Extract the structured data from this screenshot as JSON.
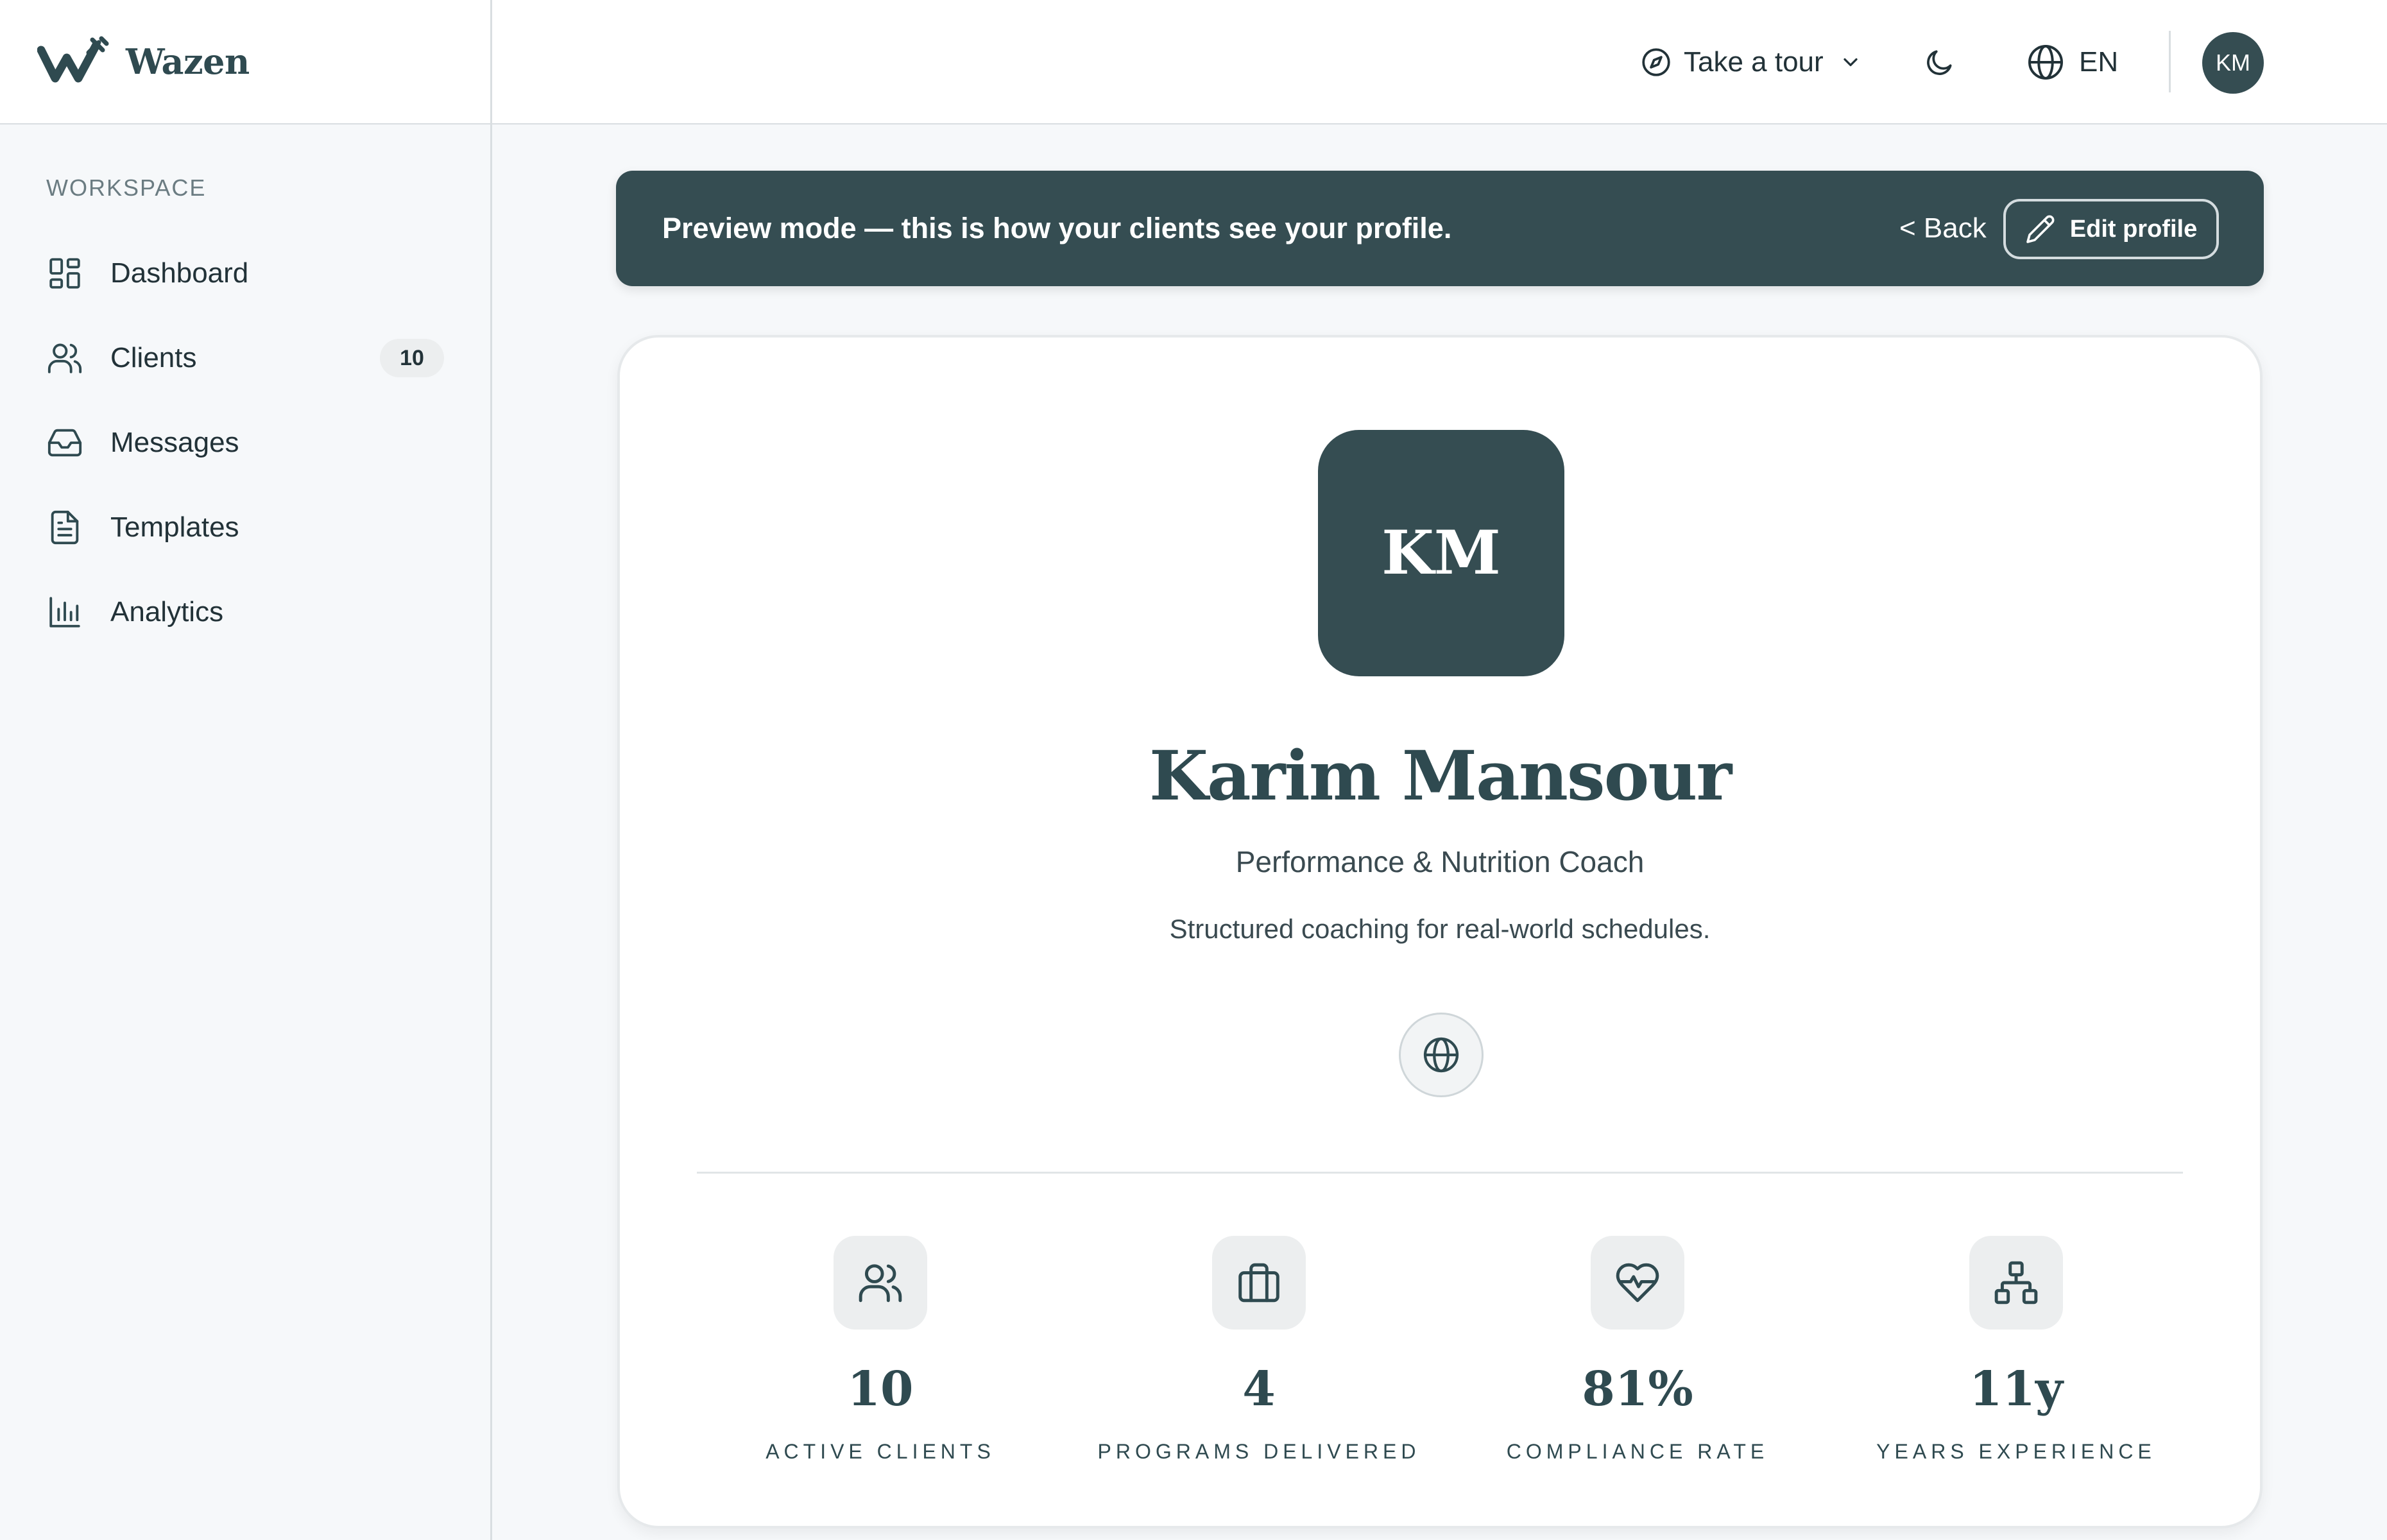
{
  "brand": {
    "name": "Wazen",
    "logo_icon": "wazen-logo-icon"
  },
  "header": {
    "tour_label": "Take a tour",
    "language_label": "EN",
    "avatar_initials": "KM"
  },
  "sidebar": {
    "section_label": "WORKSPACE",
    "items": [
      {
        "label": "Dashboard",
        "icon": "dashboard-icon"
      },
      {
        "label": "Clients",
        "icon": "users-icon",
        "badge": "10"
      },
      {
        "label": "Messages",
        "icon": "inbox-icon"
      },
      {
        "label": "Templates",
        "icon": "document-icon"
      },
      {
        "label": "Analytics",
        "icon": "bar-chart-icon"
      }
    ]
  },
  "banner": {
    "text": "Preview mode — this is how your clients see your profile.",
    "back_label": "< Back",
    "edit_label": "Edit profile"
  },
  "profile": {
    "initials": "KM",
    "name": "Karim Mansour",
    "role": "Performance & Nutrition Coach",
    "tagline": "Structured coaching for real-world schedules.",
    "website_icon": "globe-icon"
  },
  "stats": [
    {
      "value": "10",
      "label": "ACTIVE CLIENTS",
      "icon": "users-icon"
    },
    {
      "value": "4",
      "label": "PROGRAMS DELIVERED",
      "icon": "briefcase-icon"
    },
    {
      "value": "81%",
      "label": "COMPLIANCE RATE",
      "icon": "heart-pulse-icon"
    },
    {
      "value": "11y",
      "label": "YEARS EXPERIENCE",
      "icon": "org-chart-icon"
    }
  ],
  "colors": {
    "primary": "#354d52",
    "background": "#f6f8fa",
    "text": "#223238",
    "badge_bg": "#eceeef"
  }
}
